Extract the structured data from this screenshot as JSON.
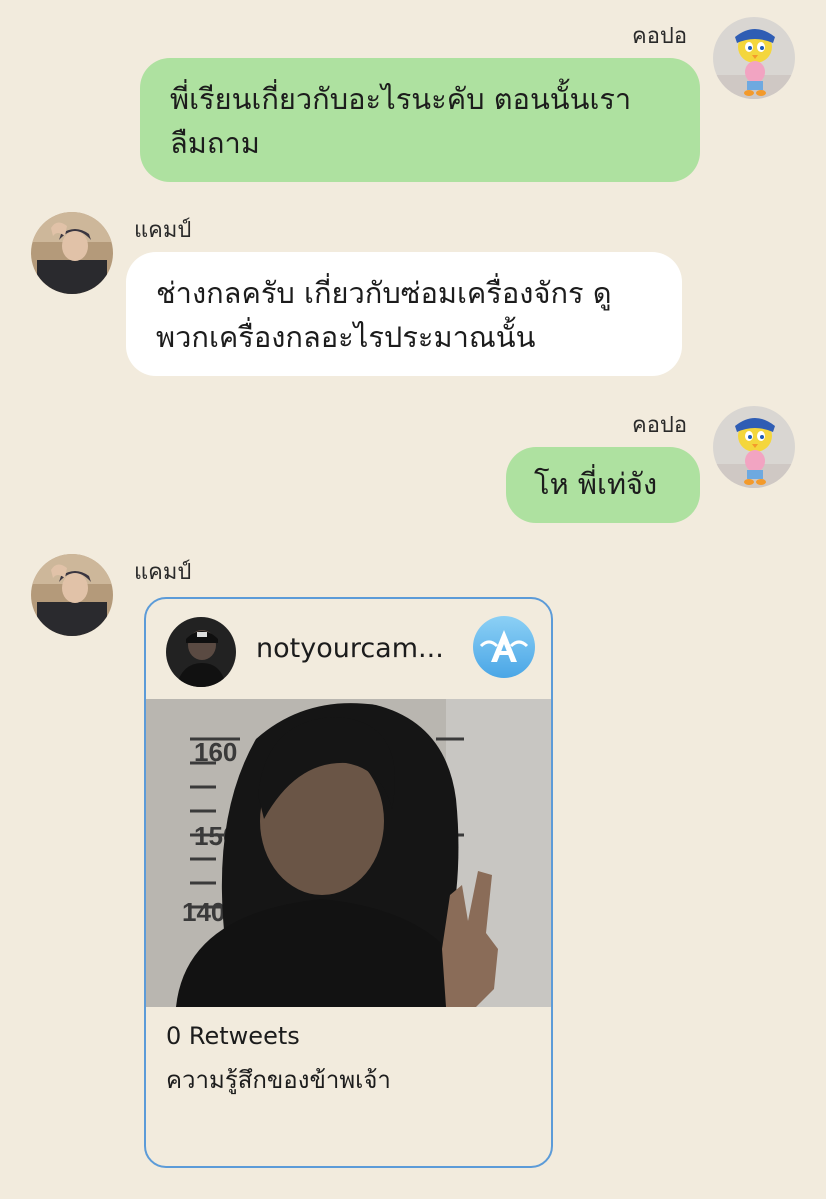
{
  "messages": [
    {
      "sender": "คอปอ",
      "side": "right",
      "text_lines": [
        "พี่เรียนเกี่ยวกับอะไรนะคับ ตอนนั้นเรา",
        "ลืมถาม"
      ]
    },
    {
      "sender": "แคมป์",
      "side": "left",
      "text_lines": [
        "ช่างกลครับ เกี่ยวกับซ่อมเครื่องจักร ดู",
        "พวกเครื่องกลอะไรประมาณนั้น"
      ]
    },
    {
      "sender": "คอปอ",
      "side": "right",
      "text_lines": [
        "โห พี่เท่จัง"
      ]
    },
    {
      "sender": "แคมป์",
      "side": "left",
      "card": {
        "username": "notyourcam...",
        "retweets": "0 Retweets",
        "caption": "ความรู้สึกของข้าพเจ้า",
        "app_badge_icon": "altstore-icon",
        "photo_scale_marks": [
          "160",
          "150",
          "140"
        ]
      }
    }
  ],
  "colors": {
    "background": "#f2ebdd",
    "my_bubble": "#aee1a0",
    "their_bubble": "#ffffff",
    "card_border": "#5c9bd8"
  }
}
